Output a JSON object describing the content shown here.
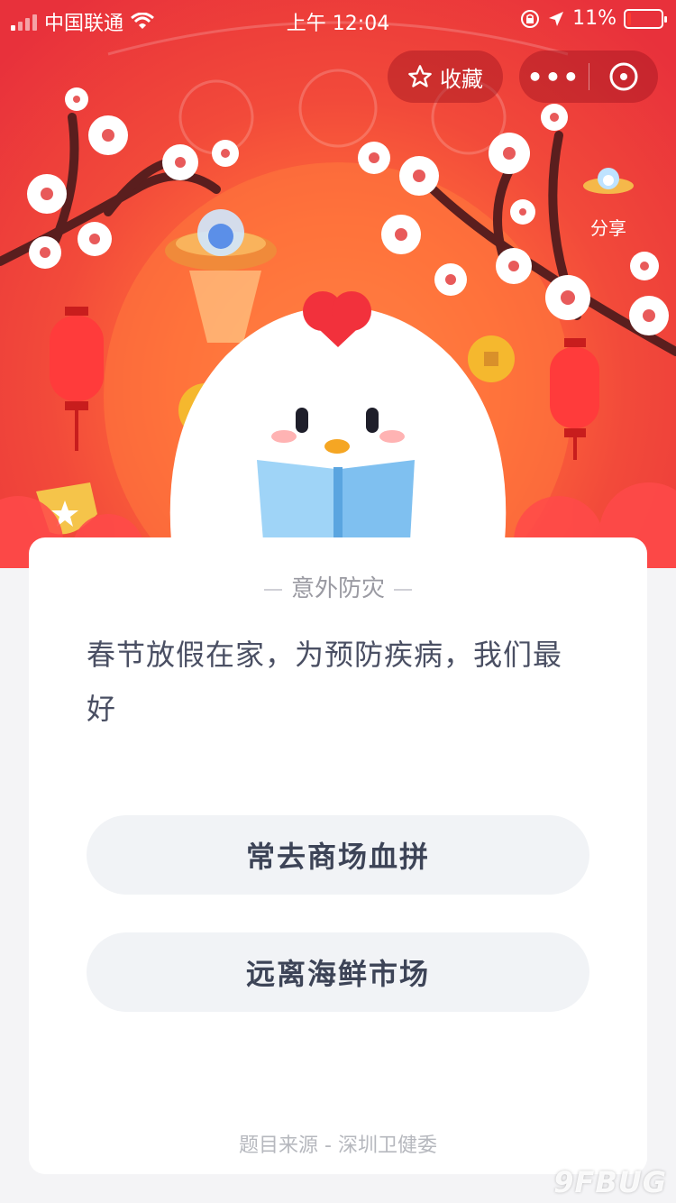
{
  "status_bar": {
    "carrier": "中国联通",
    "time": "上午 12:04",
    "battery_percent": "11%",
    "battery_level": 0.11
  },
  "header": {
    "favorite_label": "收藏",
    "more_label": "•••",
    "share_label": "分享"
  },
  "quiz": {
    "category": "意外防灾",
    "question": "春节放假在家，为预防疾病，我们最好",
    "options": [
      {
        "label": "常去商场血拼"
      },
      {
        "label": "远离海鲜市场"
      }
    ],
    "source": "题目来源 - 深圳卫健委"
  },
  "watermark": "9FBUG"
}
